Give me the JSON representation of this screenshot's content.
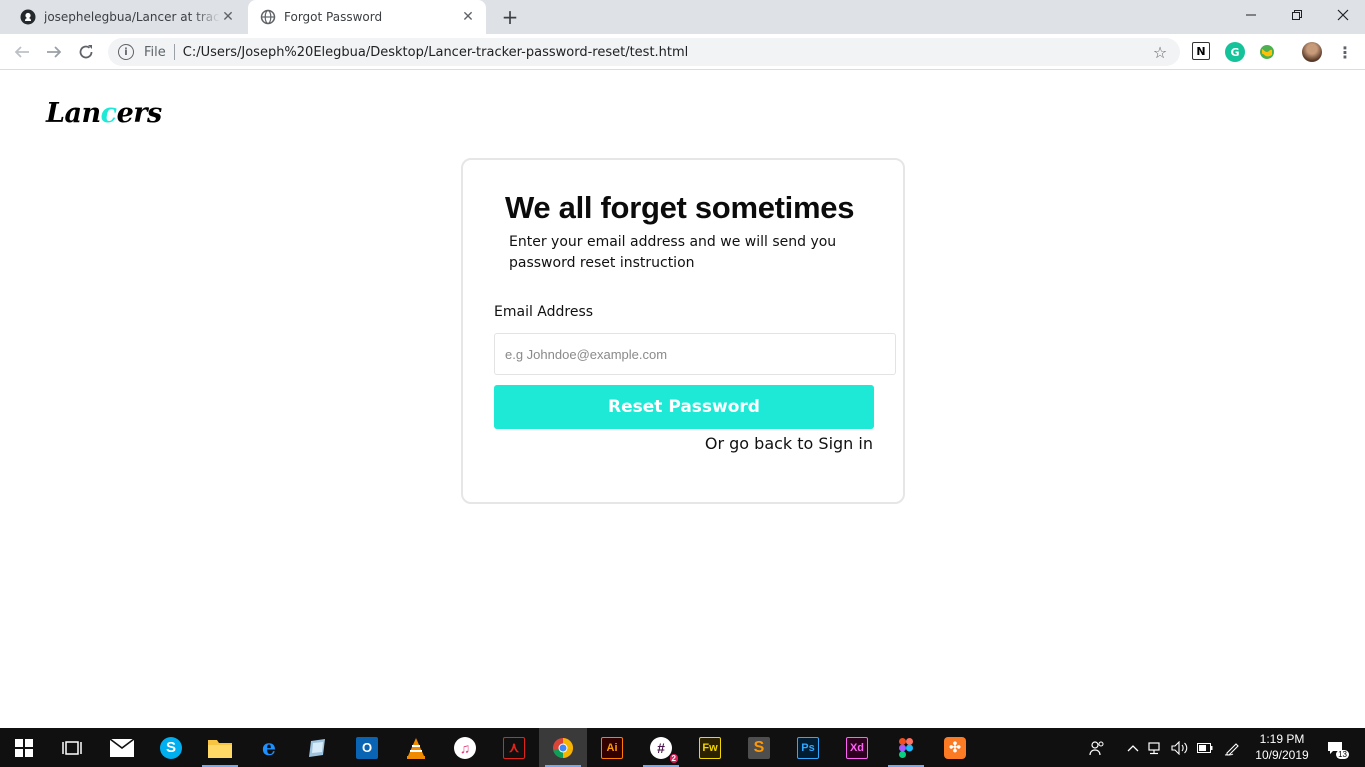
{
  "browser": {
    "tabs": [
      {
        "label": "josephelegbua/Lancer at tracker-",
        "icon": "github-icon"
      },
      {
        "label": "Forgot Password",
        "icon": "globe-icon"
      }
    ],
    "address": {
      "scheme": "File",
      "url": "C:/Users/Joseph%20Elegbua/Desktop/Lancer-tracker-password-reset/test.html"
    },
    "extensions": [
      "notion-icon",
      "grammarly-icon",
      "globe-extension-icon",
      "profile-avatar"
    ]
  },
  "page": {
    "logo": {
      "prefix": "Lan",
      "accent": "c",
      "suffix": "ers"
    },
    "card": {
      "heading": "We all forget sometimes",
      "subtext": "Enter your email address and we will send you password reset instruction",
      "email_label": "Email Address",
      "email_placeholder": "e.g Johndoe@example.com",
      "email_value": "",
      "reset_button": "Reset Password",
      "back_link": "Or go back to Sign in"
    },
    "colors": {
      "accent": "#1de9d6"
    }
  },
  "taskbar": {
    "apps": [
      "start-icon",
      "task-view-icon",
      "mail-icon",
      "skype-icon",
      "file-explorer-icon",
      "edge-icon",
      "notepad-icon",
      "outlook-icon",
      "vlc-icon",
      "itunes-icon",
      "acrobat-icon",
      "chrome-icon",
      "illustrator-icon",
      "slack-icon",
      "fireworks-icon",
      "sublime-icon",
      "photoshop-icon",
      "xd-icon",
      "figma-icon",
      "xampp-icon"
    ],
    "labels": {
      "illustrator": "Ai",
      "fireworks": "Fw",
      "photoshop": "Ps",
      "xd": "Xd",
      "slack_badge": "2"
    },
    "clock": {
      "time": "1:19 PM",
      "date": "10/9/2019"
    },
    "notifications": "13"
  }
}
